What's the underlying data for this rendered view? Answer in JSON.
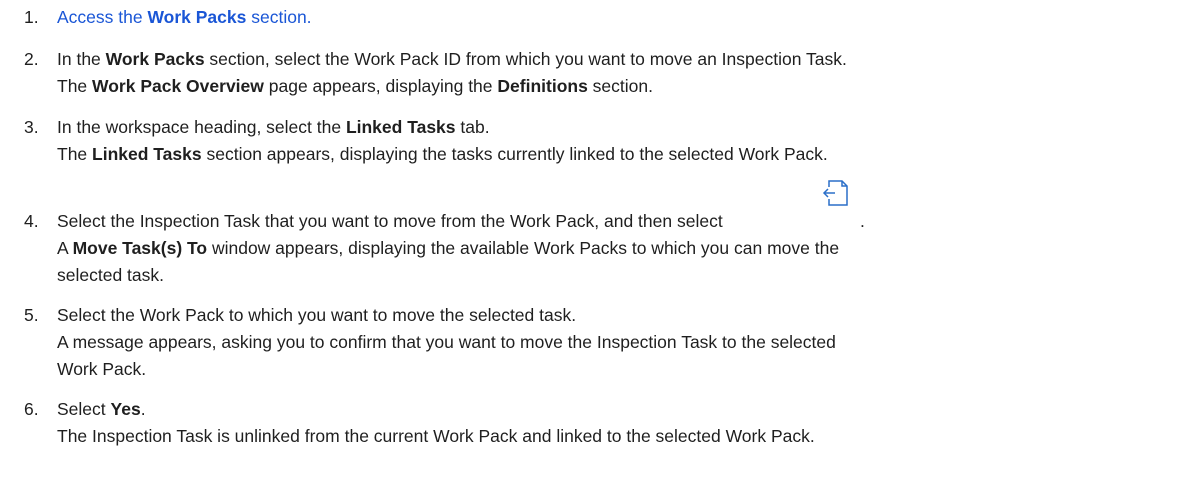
{
  "steps": [
    {
      "number": "1.",
      "text_before": "Access the ",
      "link_bold": "Work Packs",
      "text_after": " section."
    },
    {
      "number": "2.",
      "l1_a": "In the ",
      "l1_b": "Work Packs",
      "l1_c": " section, select the Work Pack ID from which you want to move an Inspection Task.",
      "l2_a": "The ",
      "l2_b": "Work Pack Overview",
      "l2_c": " page appears, displaying the ",
      "l2_d": "Definitions",
      "l2_e": " section."
    },
    {
      "number": "3.",
      "l1_a": "In the workspace heading, select the ",
      "l1_b": "Linked Tasks",
      "l1_c": " tab.",
      "l2_a": "The ",
      "l2_b": "Linked Tasks",
      "l2_c": " section appears, displaying the tasks currently linked to the selected Work Pack."
    },
    {
      "number": "4.",
      "l1": "Select the Inspection Task that you want to move from the Work Pack, and then select",
      "l1_period": ".",
      "icon": "move-task-icon",
      "l2_a": "A ",
      "l2_b": "Move Task(s) To",
      "l2_c": " window appears, displaying the available Work Packs to which you can move the",
      "l3": "selected task."
    },
    {
      "number": "5.",
      "l1": "Select the Work Pack to which you want to move the selected task.",
      "l2": "A message appears, asking you to confirm that you want to move the Inspection Task to the selected",
      "l3": "Work Pack."
    },
    {
      "number": "6.",
      "l1_a": "Select ",
      "l1_b": "Yes",
      "l1_c": ".",
      "l2": "The Inspection Task is unlinked from the current Work Pack and linked to the selected Work Pack."
    }
  ],
  "colors": {
    "link": "#1a56d6",
    "text": "#1f1f1f",
    "icon": "#2a6fc9"
  }
}
